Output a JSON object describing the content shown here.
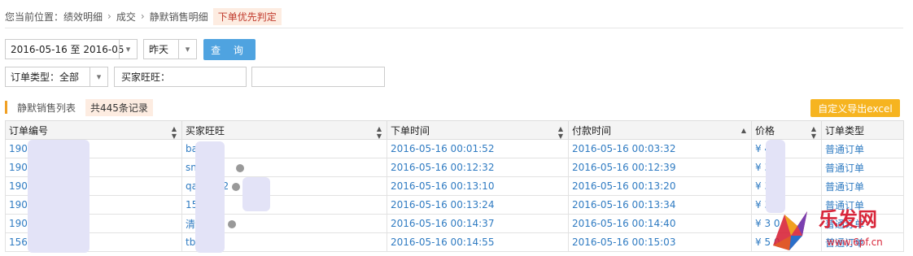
{
  "breadcrumb": {
    "label": "您当前位置：",
    "items": [
      "绩效明细",
      "成交",
      "静默销售明细"
    ],
    "badge": "下单优先判定"
  },
  "filters": {
    "date_range": "2016-05-16 至 2016-05",
    "day": "昨天",
    "query_button": "查 询",
    "order_type": "订单类型：全部",
    "buyer_label": "买家旺旺：",
    "buyer_value": "",
    "extra_value": ""
  },
  "list": {
    "title": "静默销售列表",
    "count": "共445条记录",
    "export_button": "自定义导出excel"
  },
  "table": {
    "columns": [
      "订单编号",
      "买家旺旺",
      "下单时间",
      "付款时间",
      "价格",
      "订单类型"
    ],
    "rows": [
      {
        "order": "190               52",
        "buyer": "ba         yz",
        "order_time": "2016-05-16 00:01:52",
        "pay_time": "2016-05-16 00:03:32",
        "price": "¥ 4      0",
        "type": "普通订单"
      },
      {
        "order": "190               30",
        "buyer": "sn",
        "order_time": "2016-05-16 00:12:32",
        "pay_time": "2016-05-16 00:12:39",
        "price": "¥ 3      0",
        "type": "普通订单"
      },
      {
        "order": "190               35",
        "buyer": "qa         606        2",
        "order_time": "2016-05-16 00:13:10",
        "pay_time": "2016-05-16 00:13:20",
        "price": "¥ 3      0",
        "type": "普通订单"
      },
      {
        "order": "190               61",
        "buyer": "15          915",
        "order_time": "2016-05-16 00:13:24",
        "pay_time": "2016-05-16 00:13:34",
        "price": "¥ 3      0",
        "type": "普通订单"
      },
      {
        "order": "190               50",
        "buyer": "清",
        "order_time": "2016-05-16 00:14:37",
        "pay_time": "2016-05-16 00:14:40",
        "price": "¥ 3      0",
        "type": "普通订单"
      },
      {
        "order": "156               91",
        "buyer": "tb          31",
        "order_time": "2016-05-16 00:14:55",
        "pay_time": "2016-05-16 00:15:03",
        "price": "¥ 5      0",
        "type": "普通订单"
      }
    ]
  },
  "watermark": {
    "brand": "乐发网",
    "url": "www.6pf.cn"
  },
  "colors": {
    "link": "#2f7bc2",
    "query_button": "#4fa3e0",
    "export_button": "#f6b420",
    "badge_bg": "#fdece1",
    "badge_text": "#c0392b"
  }
}
